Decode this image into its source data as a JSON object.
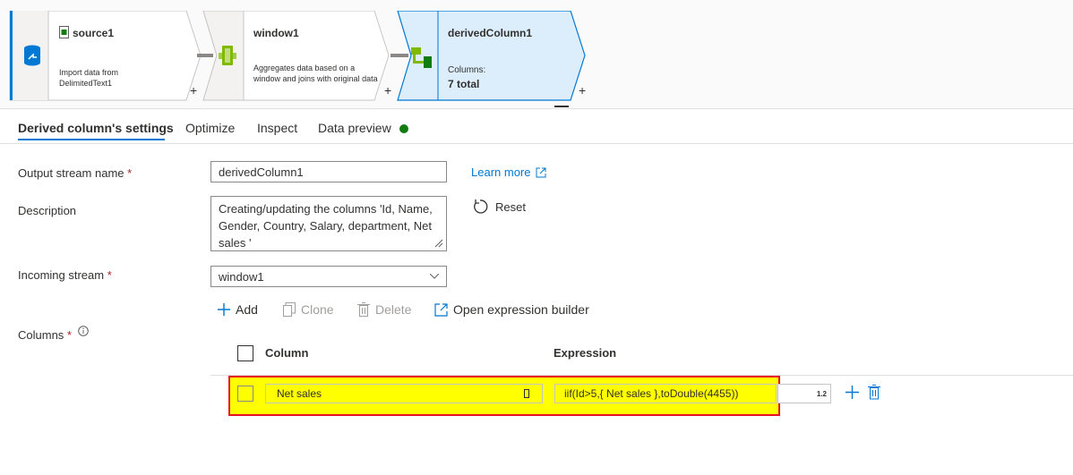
{
  "pipeline": {
    "nodes": [
      {
        "title": "source1",
        "description": "Import data from DelimitedText1"
      },
      {
        "title": "window1",
        "description": "Aggregates data based on a window and joins with original data"
      },
      {
        "title": "derivedColumn1",
        "columns_label": "Columns:",
        "columns_total": "7 total"
      }
    ],
    "plus": "+"
  },
  "tabs": [
    "Derived column's settings",
    "Optimize",
    "Inspect",
    "Data preview"
  ],
  "form": {
    "output_stream_label": "Output stream name",
    "output_stream_value": "derivedColumn1",
    "learn_more": "Learn more",
    "description_label": "Description",
    "description_value": "Creating/updating the columns 'Id, Name, Gender, Country, Salary, department,  Net sales '",
    "reset_label": "Reset",
    "incoming_stream_label": "Incoming stream",
    "incoming_stream_value": "window1",
    "columns_label": "Columns",
    "required_mark": "*"
  },
  "toolbar": {
    "add": "Add",
    "clone": "Clone",
    "delete": "Delete",
    "open_builder": "Open expression builder"
  },
  "table": {
    "headers": {
      "column": "Column",
      "expression": "Expression"
    },
    "rows": [
      {
        "column": "Net sales",
        "expression": "iif(Id>5,{ Net sales },toDouble(4455))",
        "type_badge": "1.2"
      }
    ]
  },
  "colors": {
    "accent": "#0078d4",
    "highlight": "#ffff00",
    "highlight_border": "#e81123",
    "status_dot": "#107c10"
  }
}
